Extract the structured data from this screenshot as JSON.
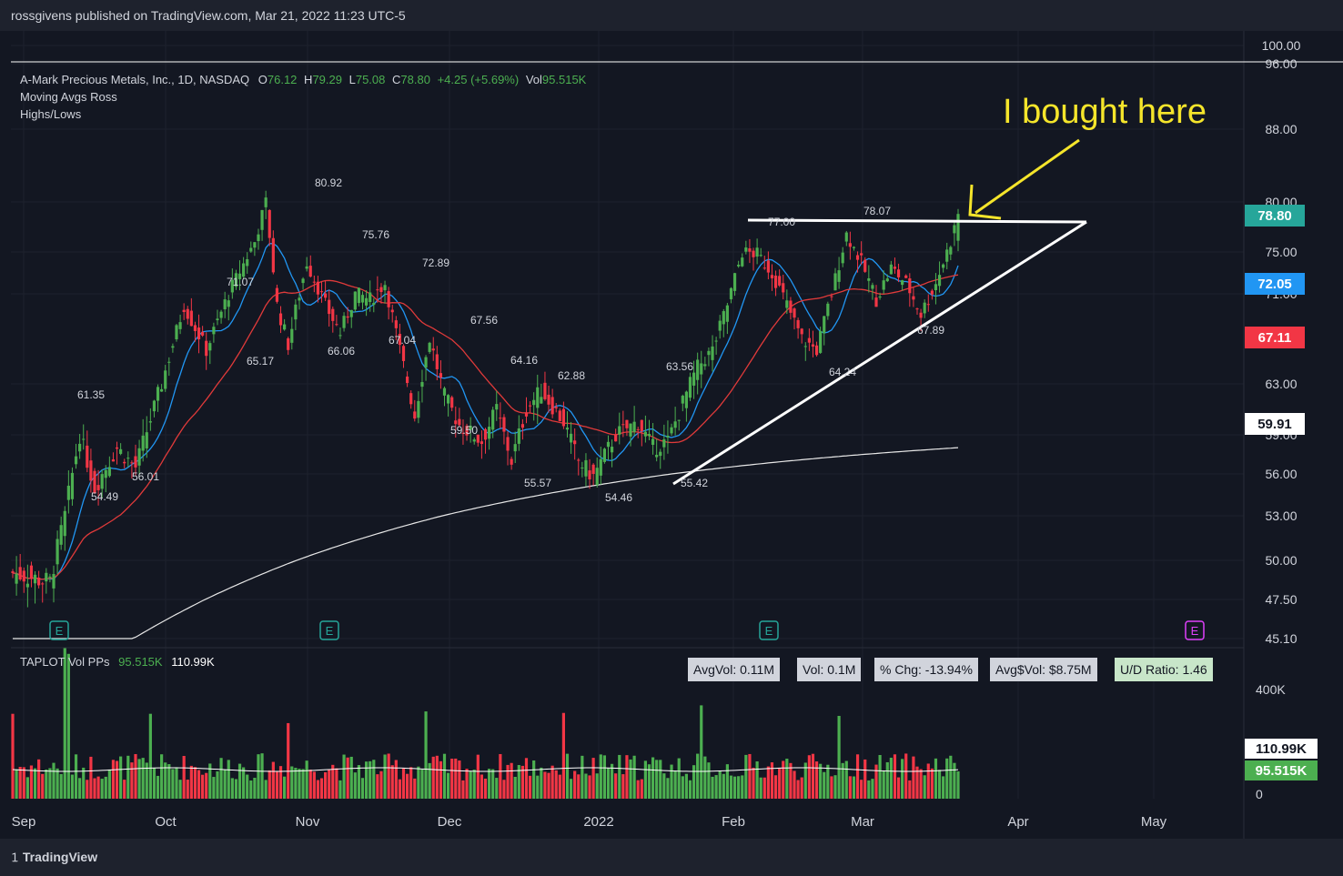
{
  "header": {
    "published": "rossgivens published on TradingView.com, Mar 21, 2022 11:23 UTC-5"
  },
  "footer": {
    "brand": "TradingView"
  },
  "legend": {
    "symbol": "A-Mark Precious Metals, Inc., 1D, NASDAQ",
    "o_label": "O",
    "o_val": "76.12",
    "h_label": "H",
    "h_val": "79.29",
    "l_label": "L",
    "l_val": "75.08",
    "c_label": "C",
    "c_val": "78.80",
    "change": "+4.25 (+5.69%)",
    "vol_label": "Vol",
    "vol_val": "95.515K",
    "ind1": "Moving Avgs Ross",
    "ind2": "Highs/Lows"
  },
  "volume_legend": {
    "name": "TAPLOT Vol PPs",
    "v1": "95.515K",
    "v2": "110.99K"
  },
  "stats": {
    "avgvol": "AvgVol: 0.11M",
    "vol": "Vol: 0.1M",
    "pchg": "% Chg: -13.94%",
    "avgdvol": "Avg$Vol: $8.75M",
    "ud": "U/D Ratio: 1.46"
  },
  "annotation": "I bought here",
  "colors": {
    "up": "#26a69a",
    "up_bright": "#4caf50",
    "down": "#f23645",
    "ma_blue": "#2196f3",
    "ma_red": "#e03a3a",
    "ma_white": "#e8e8e8",
    "annot": "#f5e52b"
  },
  "chart_data": {
    "type": "candlestick",
    "price_axis_ticks": [
      "100.00",
      "96.00",
      "88.00",
      "80.00",
      "75.00",
      "71.00",
      "63.00",
      "59.00",
      "56.00",
      "53.00",
      "50.00",
      "47.50",
      "45.10"
    ],
    "price_badges": [
      {
        "label": "78.80",
        "color": "#26a69a"
      },
      {
        "label": "72.05",
        "color": "#2196f3"
      },
      {
        "label": "67.11",
        "color": "#f23645"
      },
      {
        "label": "59.91",
        "color": "#ffffff"
      }
    ],
    "volume_axis_ticks": [
      "400K",
      "0"
    ],
    "volume_badges": [
      {
        "label": "110.99K",
        "color": "#ffffff"
      },
      {
        "label": "95.515K",
        "color": "#4caf50"
      }
    ],
    "x_labels": [
      "Sep",
      "Oct",
      "Nov",
      "Dec",
      "2022",
      "Feb",
      "Mar",
      "Apr",
      "May"
    ],
    "swing_labels": [
      "61.35",
      "54.49",
      "56.01",
      "71.07",
      "65.17",
      "80.92",
      "66.06",
      "75.76",
      "67.04",
      "72.89",
      "59.50",
      "67.56",
      "64.16",
      "55.57",
      "62.88",
      "54.46",
      "63.56",
      "55.42",
      "77.00",
      "64.24",
      "78.07",
      "67.89"
    ],
    "earnings_markers": [
      "E",
      "E",
      "E",
      "E"
    ],
    "last_ohlc": {
      "open": 76.12,
      "high": 79.29,
      "low": 75.08,
      "close": 78.8
    },
    "last_volume": 95515,
    "avg_volume": 110990,
    "moving_averages": [
      {
        "color": "#2196f3",
        "last": 72.05
      },
      {
        "color": "#e03a3a",
        "last": 67.11
      },
      {
        "color": "#e8e8e8",
        "last": 59.91
      }
    ]
  }
}
